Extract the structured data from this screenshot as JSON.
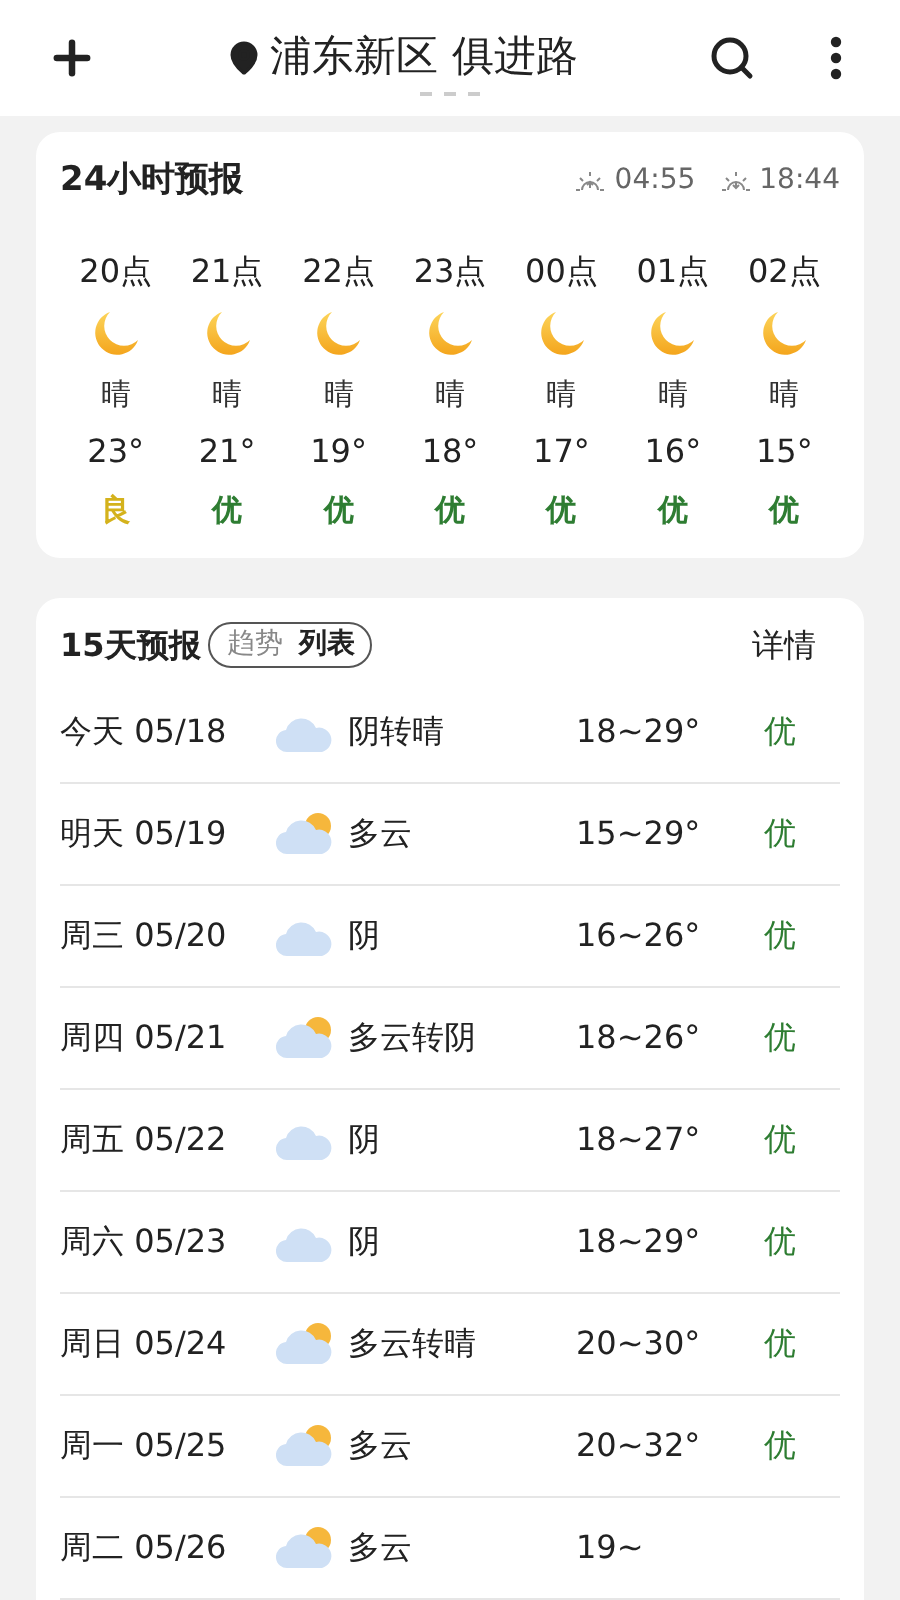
{
  "header": {
    "location": "浦东新区 俱进路"
  },
  "hourly": {
    "title": "24小时预报",
    "sunrise": "04:55",
    "sunset": "18:44",
    "items": [
      {
        "time": "20点",
        "kind": "moon",
        "weather": "晴",
        "temp": "23°",
        "quality": "良",
        "color": "#d4b21c"
      },
      {
        "time": "21点",
        "kind": "moon",
        "weather": "晴",
        "temp": "21°",
        "quality": "优",
        "color": "#2e7d32"
      },
      {
        "time": "22点",
        "kind": "moon",
        "weather": "晴",
        "temp": "19°",
        "quality": "优",
        "color": "#2e7d32"
      },
      {
        "time": "23点",
        "kind": "moon",
        "weather": "晴",
        "temp": "18°",
        "quality": "优",
        "color": "#2e7d32"
      },
      {
        "time": "00点",
        "kind": "moon",
        "weather": "晴",
        "temp": "17°",
        "quality": "优",
        "color": "#2e7d32"
      },
      {
        "time": "01点",
        "kind": "moon",
        "weather": "晴",
        "temp": "16°",
        "quality": "优",
        "color": "#2e7d32"
      },
      {
        "time": "02点",
        "kind": "moon",
        "weather": "晴",
        "temp": "15°",
        "quality": "优",
        "color": "#2e7d32"
      }
    ]
  },
  "daily": {
    "title": "15天预报",
    "tabs": [
      {
        "label": "趋势",
        "selected": false
      },
      {
        "label": "列表",
        "selected": true
      }
    ],
    "detail": "详情",
    "rows": [
      {
        "date": "今天 05/18",
        "kind": "cloudy",
        "weather": "阴转晴",
        "temp": "18~29°",
        "quality": "优"
      },
      {
        "date": "明天 05/19",
        "kind": "partly",
        "weather": "多云",
        "temp": "15~29°",
        "quality": "优"
      },
      {
        "date": "周三 05/20",
        "kind": "cloudy",
        "weather": "阴",
        "temp": "16~26°",
        "quality": "优"
      },
      {
        "date": "周四 05/21",
        "kind": "partly",
        "weather": "多云转阴",
        "temp": "18~26°",
        "quality": "优"
      },
      {
        "date": "周五 05/22",
        "kind": "cloudy",
        "weather": "阴",
        "temp": "18~27°",
        "quality": "优"
      },
      {
        "date": "周六 05/23",
        "kind": "cloudy",
        "weather": "阴",
        "temp": "18~29°",
        "quality": "优"
      },
      {
        "date": "周日 05/24",
        "kind": "partly",
        "weather": "多云转晴",
        "temp": "20~30°",
        "quality": "优"
      },
      {
        "date": "周一 05/25",
        "kind": "partly",
        "weather": "多云",
        "temp": "20~32°",
        "quality": "优"
      },
      {
        "date": "周二 05/26",
        "kind": "partly",
        "weather": "多云",
        "temp": "19~"
      }
    ]
  }
}
